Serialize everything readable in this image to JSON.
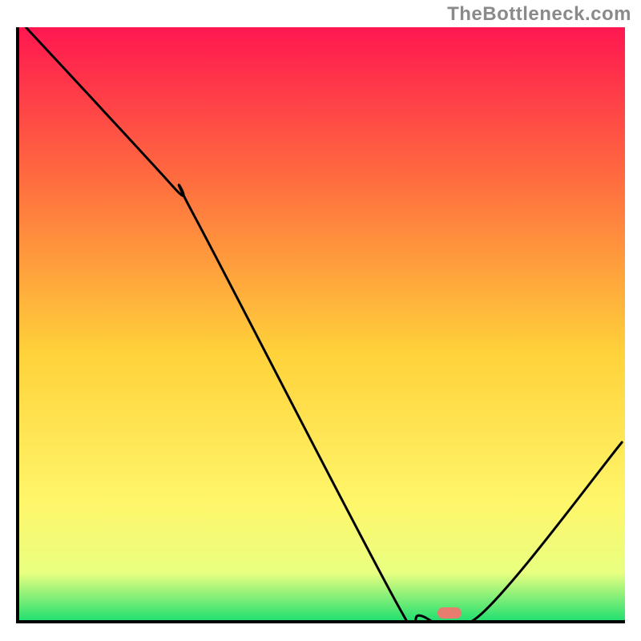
{
  "attribution": "TheBottleneck.com",
  "chart_data": {
    "type": "line",
    "title": "",
    "xlabel": "",
    "ylabel": "",
    "xlim": [
      0,
      100
    ],
    "ylim": [
      0,
      100
    ],
    "gradient_stops": [
      {
        "pos": 0,
        "color": "#ff1750"
      },
      {
        "pos": 25,
        "color": "#ff6a3f"
      },
      {
        "pos": 55,
        "color": "#ffd23a"
      },
      {
        "pos": 80,
        "color": "#fff66a"
      },
      {
        "pos": 92,
        "color": "#e9ff80"
      },
      {
        "pos": 100,
        "color": "#24e070"
      }
    ],
    "curve": [
      {
        "x": 1.1,
        "y": 100.0
      },
      {
        "x": 25.5,
        "y": 73.0
      },
      {
        "x": 29.0,
        "y": 68.0
      },
      {
        "x": 63.0,
        "y": 1.6
      },
      {
        "x": 66.0,
        "y": 0.8
      },
      {
        "x": 76.0,
        "y": 0.8
      },
      {
        "x": 99.5,
        "y": 30.0
      }
    ],
    "optimal_marker": {
      "x": 71.0,
      "y": 1.2
    }
  }
}
